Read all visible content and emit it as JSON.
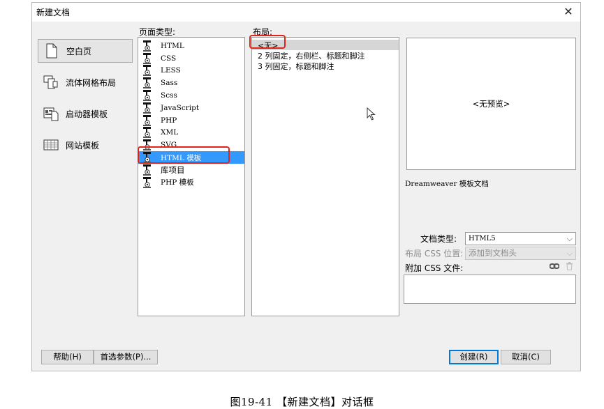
{
  "dialog": {
    "title": "新建文档",
    "close_icon": "close-icon"
  },
  "categories": [
    {
      "label": "空白页",
      "icon": "blank-page-icon",
      "active": true
    },
    {
      "label": "流体网格布局",
      "icon": "fluid-grid-icon",
      "active": false
    },
    {
      "label": "启动器模板",
      "icon": "starter-template-icon",
      "active": false
    },
    {
      "label": "网站模板",
      "icon": "site-template-icon",
      "active": false
    }
  ],
  "page_type": {
    "label": "页面类型:",
    "items": [
      "HTML",
      "CSS",
      "LESS",
      "Sass",
      "Scss",
      "JavaScript",
      "PHP",
      "XML",
      "SVG",
      "HTML 模板",
      "库项目",
      "PHP 模板"
    ],
    "selected": "HTML 模板"
  },
  "layout": {
    "label": "布局:",
    "items": [
      "<无>",
      "2 列固定，右侧栏、标题和脚注",
      "3 列固定，标题和脚注"
    ],
    "selected": "<无>"
  },
  "preview": {
    "text": "<无预览>",
    "description": "Dreamweaver 模板文档"
  },
  "options": {
    "doctype_label": "文档类型:",
    "doctype_value": "HTML5",
    "css_position_label": "布局 CSS 位置:",
    "css_position_value": "添加到文档头",
    "attach_css_label": "附加 CSS 文件:"
  },
  "buttons": {
    "help": "帮助(H)",
    "preferences": "首选参数(P)...",
    "create": "创建(R)",
    "cancel": "取消(C)"
  },
  "caption": "图19-41 【新建文档】对话框",
  "colors": {
    "selection": "#3399ff",
    "highlight_box": "#e2231a"
  }
}
